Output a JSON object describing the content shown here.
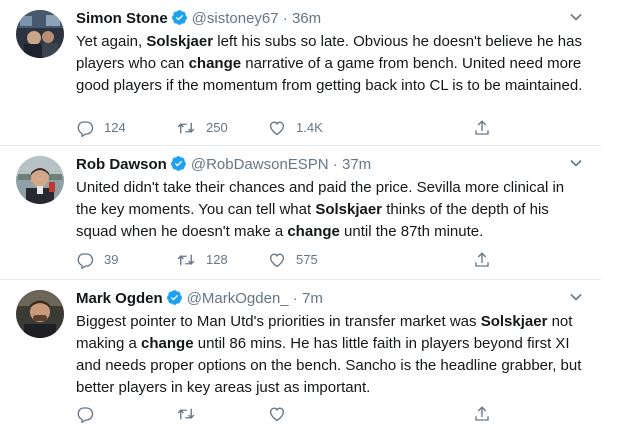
{
  "tweets": [
    {
      "name": "Simon Stone",
      "handle": "@sistoney67",
      "dot": "·",
      "time": "36m",
      "text": [
        {
          "t": "Yet again, "
        },
        {
          "t": "Solskjaer",
          "b": true
        },
        {
          "t": " left his subs so late. Obvious he doesn't believe he has players who can "
        },
        {
          "t": "change",
          "b": true
        },
        {
          "t": " narrative of a game from bench. United need more good players if the momentum from getting back into CL is to be maintained."
        }
      ],
      "replies": "124",
      "retweets": "250",
      "likes": "1.4K",
      "avatar_icon": "avatar-photo-icon"
    },
    {
      "name": "Rob Dawson",
      "handle": "@RobDawsonESPN",
      "dot": "·",
      "time": "37m",
      "text": [
        {
          "t": "United didn't take their chances and paid the price. Sevilla more clinical in the key moments. You can tell what "
        },
        {
          "t": "Solskjaer",
          "b": true
        },
        {
          "t": " thinks of the depth of his squad when he doesn't make a "
        },
        {
          "t": "change",
          "b": true
        },
        {
          "t": " until the 87th minute."
        }
      ],
      "replies": "39",
      "retweets": "128",
      "likes": "575",
      "avatar_icon": "avatar-photo-icon"
    },
    {
      "name": "Mark Ogden",
      "handle": "@MarkOgden_",
      "dot": "·",
      "time": "7m",
      "text": [
        {
          "t": "Biggest pointer to Man Utd's priorities in transfer market was "
        },
        {
          "t": "Solskjaer",
          "b": true
        },
        {
          "t": " not making a "
        },
        {
          "t": "change",
          "b": true
        },
        {
          "t": " until 86 mins. He has little faith in players beyond first XI and needs proper options on the bench. Sancho is the headline grabber, but better players in key areas just as important."
        }
      ],
      "replies": "",
      "retweets": "",
      "likes": "",
      "avatar_icon": "avatar-photo-icon"
    }
  ],
  "colors": {
    "text": "#14171a",
    "secondary": "#657786",
    "verified": "#1da1f2",
    "divider": "#e6ecf0"
  }
}
